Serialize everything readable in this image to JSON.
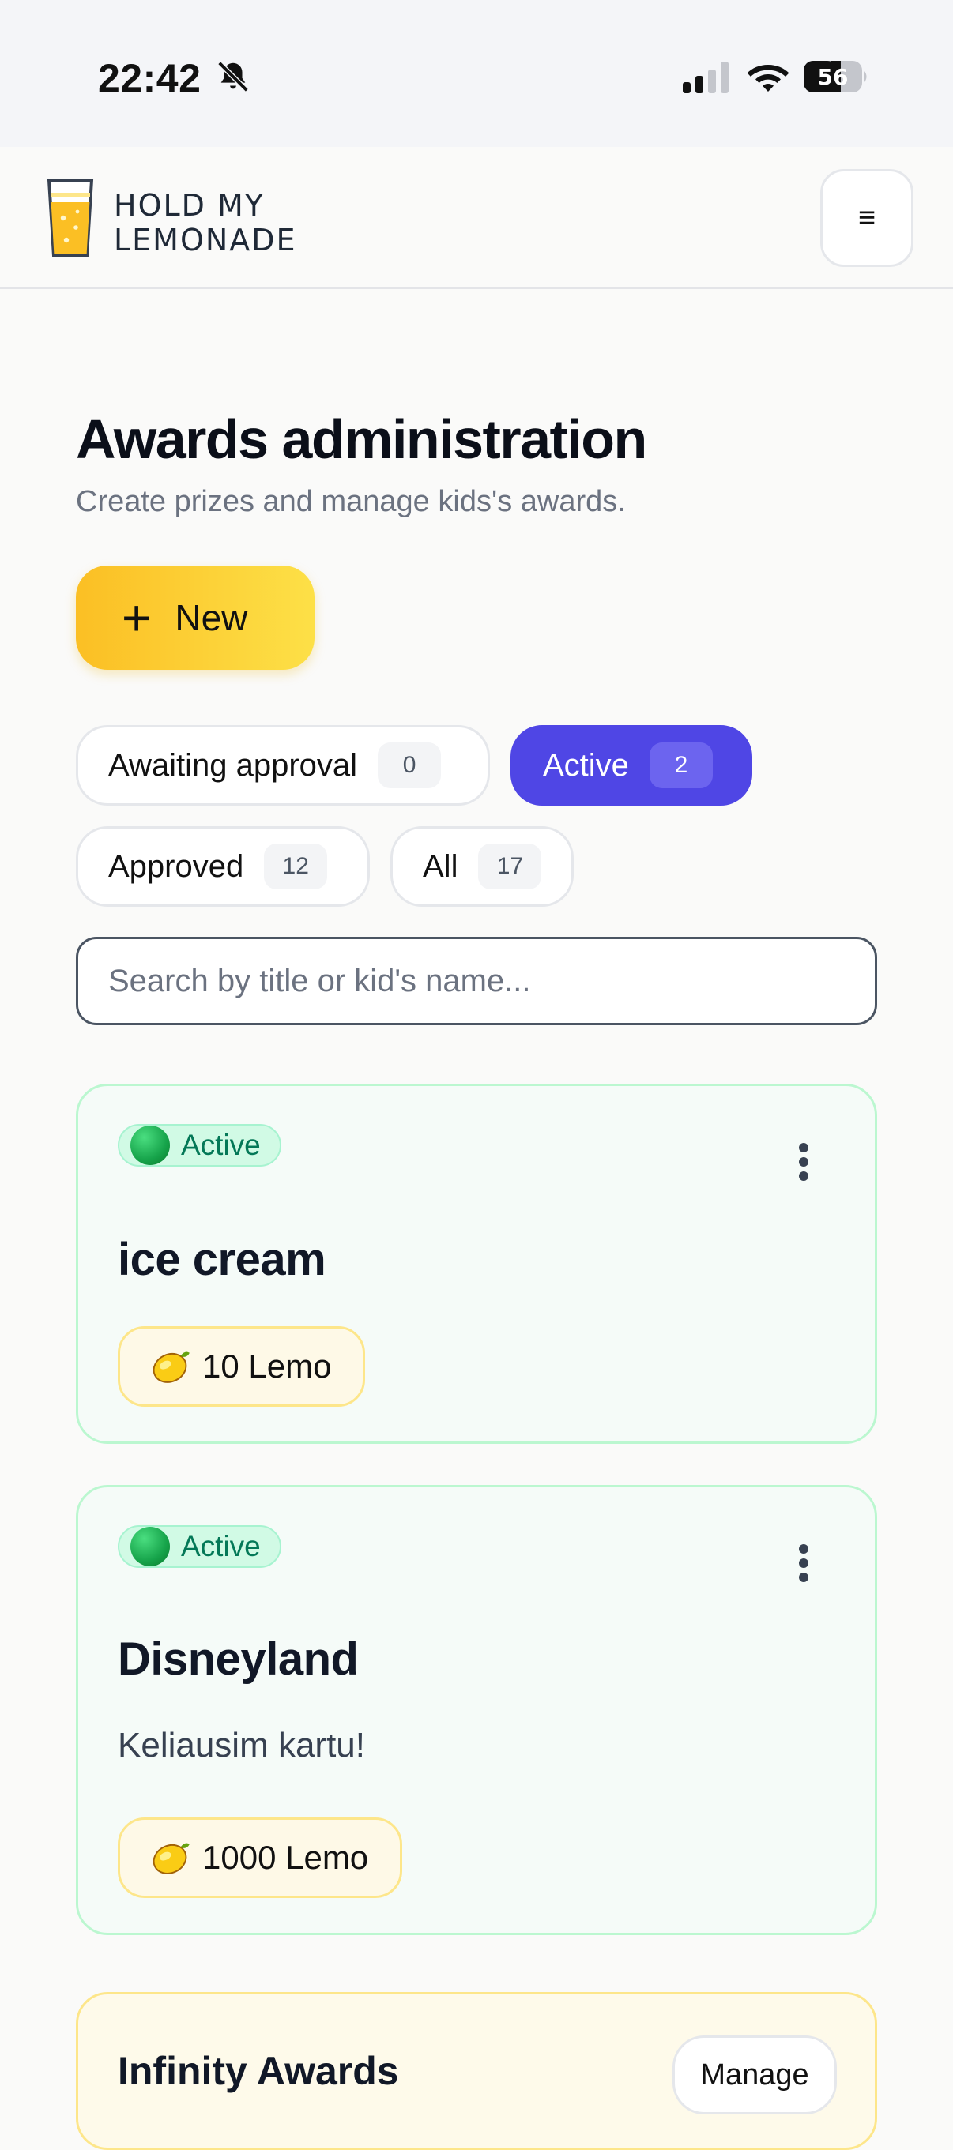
{
  "status_bar": {
    "time": "22:42",
    "battery": "56",
    "icons": [
      "bell-slash-icon",
      "signal-icon",
      "wifi-icon",
      "battery-icon"
    ]
  },
  "header": {
    "logo_line1": "HOLD MY",
    "logo_line2": "LEMONADE",
    "menu_icon": "≡"
  },
  "page": {
    "title": "Awards administration",
    "subtitle": "Create prizes and manage kids's awards.",
    "new_button_label": "New",
    "new_button_icon": "+"
  },
  "filters": [
    {
      "label": "Awaiting approval",
      "count": "0",
      "active": false
    },
    {
      "label": "Active",
      "count": "2",
      "active": true
    },
    {
      "label": "Approved",
      "count": "12",
      "active": false
    },
    {
      "label": "All",
      "count": "17",
      "active": false
    }
  ],
  "search": {
    "placeholder": "Search by title or kid's name..."
  },
  "awards": [
    {
      "status": "Active",
      "title": "ice cream",
      "description": "",
      "price": "10 Lemo"
    },
    {
      "status": "Active",
      "title": "Disneyland",
      "description": "Keliausim kartu!",
      "price": "1000 Lemo"
    }
  ],
  "infinity": {
    "title": "Infinity Awards",
    "manage_label": "Manage"
  },
  "colors": {
    "accent": "#4f46e5",
    "yellow": "#fbbf24",
    "active_green": "#047857"
  }
}
